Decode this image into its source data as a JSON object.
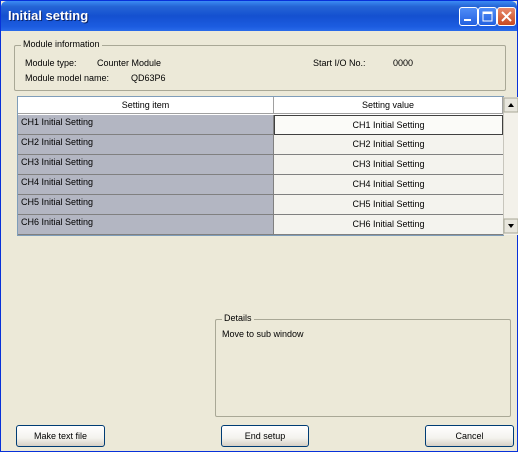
{
  "window": {
    "title": "Initial setting"
  },
  "module_info": {
    "legend": "Module information",
    "type_label": "Module type:",
    "type_value": "Counter Module",
    "start_io_label": "Start I/O No.:",
    "start_io_value": "0000",
    "model_label": "Module model name:",
    "model_value": "QD63P6"
  },
  "table": {
    "headers": [
      "Setting item",
      "Setting value"
    ],
    "rows": [
      {
        "item": "CH1 Initial Setting",
        "value": "CH1 Initial Setting"
      },
      {
        "item": "CH2 Initial Setting",
        "value": "CH2 Initial Setting"
      },
      {
        "item": "CH3 Initial Setting",
        "value": "CH3 Initial Setting"
      },
      {
        "item": "CH4 Initial Setting",
        "value": "CH4 Initial Setting"
      },
      {
        "item": "CH5 Initial Setting",
        "value": "CH5 Initial Setting"
      },
      {
        "item": "CH6 Initial Setting",
        "value": "CH6 Initial Setting"
      }
    ]
  },
  "details": {
    "legend": "Details",
    "text": "Move to sub window"
  },
  "buttons": {
    "make_text": "Make text file",
    "end_setup": "End setup",
    "cancel": "Cancel"
  },
  "colors": {
    "title_bar": "#1450d0",
    "item_cell": "#b3b6c2",
    "window_bg": "#ece9d8"
  }
}
